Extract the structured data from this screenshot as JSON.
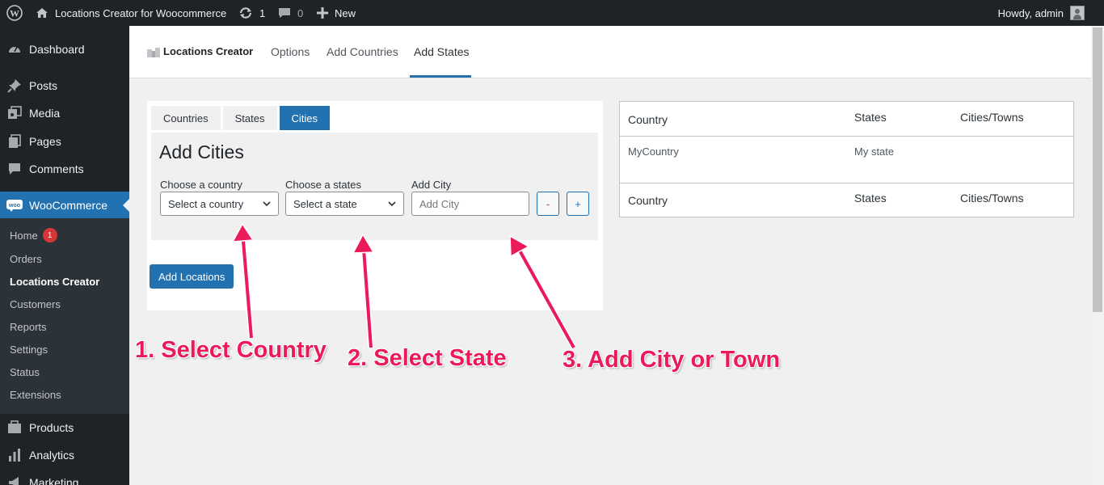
{
  "adminbar": {
    "site_title": "Locations Creator for Woocommerce",
    "updates_count": "1",
    "comments_count": "0",
    "new_label": "New",
    "howdy": "Howdy, admin"
  },
  "sidebar": {
    "items": [
      {
        "label": "Dashboard",
        "icon": "dashboard-icon"
      },
      {
        "label": "Posts",
        "icon": "pin-icon"
      },
      {
        "label": "Media",
        "icon": "media-icon"
      },
      {
        "label": "Pages",
        "icon": "pages-icon"
      },
      {
        "label": "Comments",
        "icon": "comment-icon"
      },
      {
        "label": "WooCommerce",
        "icon": "woo-icon"
      }
    ],
    "woo_submenu": [
      {
        "label": "Home",
        "badge": "1"
      },
      {
        "label": "Orders"
      },
      {
        "label": "Locations Creator"
      },
      {
        "label": "Customers"
      },
      {
        "label": "Reports"
      },
      {
        "label": "Settings"
      },
      {
        "label": "Status"
      },
      {
        "label": "Extensions"
      }
    ],
    "after_items": [
      {
        "label": "Products",
        "icon": "products-icon"
      },
      {
        "label": "Analytics",
        "icon": "analytics-icon"
      },
      {
        "label": "Marketing",
        "icon": "marketing-icon"
      }
    ]
  },
  "header": {
    "brand": "Locations Creator",
    "tabs": [
      "Options",
      "Add Countries",
      "Add States"
    ],
    "active_tab": "Add States"
  },
  "form": {
    "tabs": [
      "Countries",
      "States",
      "Cities"
    ],
    "active_tab": "Cities",
    "title": "Add Cities",
    "country_label": "Choose a country",
    "country_value": "Select a country",
    "state_label": "Choose a states",
    "state_value": "Select a state",
    "city_label": "Add City",
    "city_placeholder": "Add City",
    "minus": "-",
    "plus": "+",
    "submit": "Add Locations"
  },
  "table": {
    "columns": [
      "Country",
      "States",
      "Cities/Towns"
    ],
    "rows": [
      {
        "country": "MyCountry",
        "state": "My state",
        "cities": ""
      }
    ],
    "footer_columns": [
      "Country",
      "States",
      "Cities/Towns"
    ]
  },
  "annotations": {
    "step1": "1. Select Country",
    "step2": "2. Select State",
    "step3": "3. Add City or Town"
  },
  "colors": {
    "accent": "#2271b1",
    "annotation": "#ea1a5b",
    "adminbar": "#1d2327"
  }
}
